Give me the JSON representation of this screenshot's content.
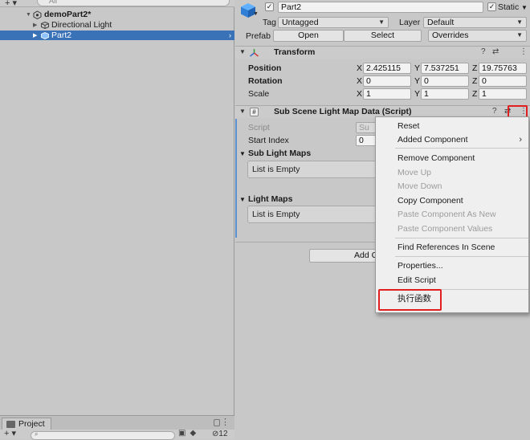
{
  "hierarchy": {
    "search_placeholder": "All",
    "add_glyph": "+ ▾",
    "scene_name": "demoPart2*",
    "items": [
      {
        "label": "Directional Light"
      },
      {
        "label": "Part2"
      }
    ]
  },
  "project": {
    "tab_label": "Project",
    "add_glyph": "+ ▾",
    "hidden_count": "12"
  },
  "inspector": {
    "object_name": "Part2",
    "static_label": "Static",
    "tag_label": "Tag",
    "tag_value": "Untagged",
    "layer_label": "Layer",
    "layer_value": "Default",
    "prefab_label": "Prefab",
    "prefab_open": "Open",
    "prefab_select": "Select",
    "prefab_overrides": "Overrides",
    "transform": {
      "title": "Transform",
      "position_label": "Position",
      "rotation_label": "Rotation",
      "scale_label": "Scale",
      "position": {
        "x": "2.425115",
        "y": "7.537251",
        "z": "19.75763"
      },
      "rotation": {
        "x": "0",
        "y": "0",
        "z": "0"
      },
      "scale": {
        "x": "1",
        "y": "1",
        "z": "1"
      }
    },
    "script_component": {
      "title": "Sub Scene Light Map Data (Script)",
      "script_label": "Script",
      "script_value": "Su",
      "start_index_label": "Start Index",
      "start_index_value": "0",
      "sub_light_maps_label": "Sub Light Maps",
      "sub_light_maps_empty": "List is Empty",
      "light_maps_label": "Light Maps",
      "light_maps_empty": "List is Empty"
    },
    "add_component_label": "Add C"
  },
  "context_menu": {
    "items": [
      {
        "label": "Reset",
        "enabled": true
      },
      {
        "label": "Added Component",
        "enabled": true,
        "submenu": "›"
      },
      {
        "label": "Remove Component",
        "enabled": true
      },
      {
        "label": "Move Up",
        "enabled": false
      },
      {
        "label": "Move Down",
        "enabled": false
      },
      {
        "label": "Copy Component",
        "enabled": true
      },
      {
        "label": "Paste Component As New",
        "enabled": false
      },
      {
        "label": "Paste Component Values",
        "enabled": false
      },
      {
        "label": "Find References In Scene",
        "enabled": true
      },
      {
        "label": "Properties...",
        "enabled": true
      },
      {
        "label": "Edit Script",
        "enabled": true
      },
      {
        "label": "执行函数",
        "enabled": true
      }
    ]
  },
  "colors": {
    "selection": "#3a72b8",
    "highlight_box": "#e02020",
    "panel_bg": "#c8c8c8"
  }
}
